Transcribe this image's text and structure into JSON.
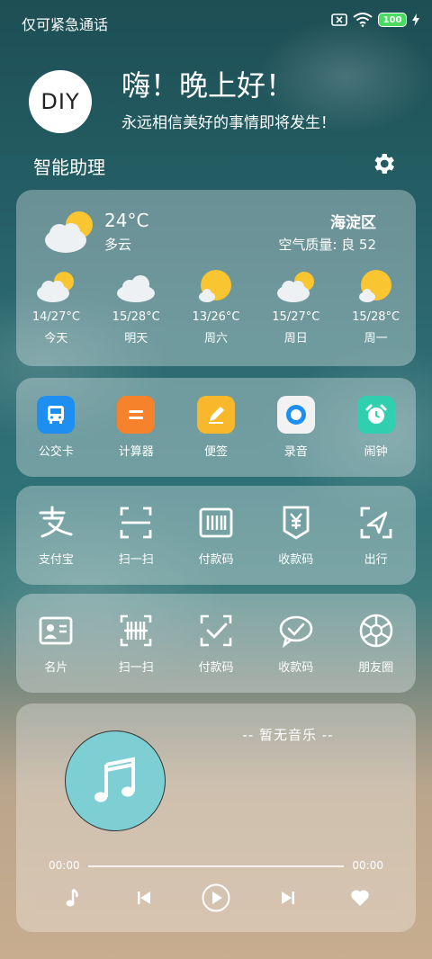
{
  "status_bar": {
    "left_text": "仅可紧急通话",
    "battery": "100"
  },
  "header": {
    "avatar_text": "DIY",
    "greeting": "嗨！晚上好！",
    "subtitle": "永远相信美好的事情即将发生！",
    "section_title": "智能助理"
  },
  "weather": {
    "temp": "24°C",
    "desc": "多云",
    "district": "海淀区",
    "aqi": "空气质量: 良 52",
    "forecast": [
      {
        "range": "14/27°C",
        "day": "今天",
        "icon": "partly-cloudy"
      },
      {
        "range": "15/28°C",
        "day": "明天",
        "icon": "cloudy"
      },
      {
        "range": "13/26°C",
        "day": "周六",
        "icon": "sunny-cloud"
      },
      {
        "range": "15/27°C",
        "day": "周日",
        "icon": "partly-cloudy"
      },
      {
        "range": "15/28°C",
        "day": "周一",
        "icon": "sunny-cloud"
      }
    ]
  },
  "apps_row1": [
    {
      "label": "公交卡",
      "icon": "bus-icon",
      "color": "#1e8ef0"
    },
    {
      "label": "计算器",
      "icon": "calculator-icon",
      "color": "#f6822b"
    },
    {
      "label": "便签",
      "icon": "notes-icon",
      "color": "#f9b82b"
    },
    {
      "label": "录音",
      "icon": "recorder-icon",
      "color": "#f2f2f2"
    },
    {
      "label": "闹钟",
      "icon": "alarm-icon",
      "color": "#2fcfb0"
    }
  ],
  "apps_row2": [
    {
      "label": "支付宝",
      "icon": "alipay-icon"
    },
    {
      "label": "扫一扫",
      "icon": "scan-icon"
    },
    {
      "label": "付款码",
      "icon": "paycode-icon"
    },
    {
      "label": "收款码",
      "icon": "receive-code-icon"
    },
    {
      "label": "出行",
      "icon": "travel-icon"
    }
  ],
  "apps_row3": [
    {
      "label": "名片",
      "icon": "card-icon"
    },
    {
      "label": "扫一扫",
      "icon": "scan-barcode-icon"
    },
    {
      "label": "付款码",
      "icon": "paycode-check-icon"
    },
    {
      "label": "收款码",
      "icon": "wechat-icon"
    },
    {
      "label": "朋友圈",
      "icon": "moments-icon"
    }
  ],
  "music": {
    "status": "-- 暂无音乐 --",
    "time_current": "00:00",
    "time_total": "00:00",
    "disc_color": "#7ecfd4"
  }
}
